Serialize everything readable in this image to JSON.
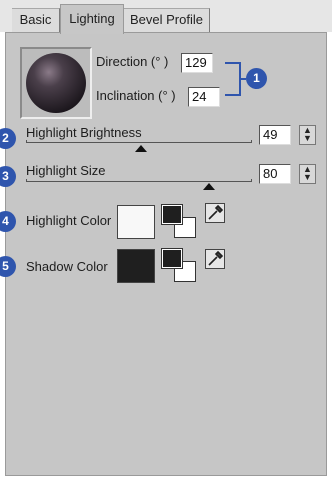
{
  "tabs": [
    {
      "label": "Basic",
      "active": false
    },
    {
      "label": "Lighting",
      "active": true
    },
    {
      "label": "Bevel Profile",
      "active": false
    }
  ],
  "lighting": {
    "direction": {
      "label": "Direction (°  )",
      "value": "129"
    },
    "inclination": {
      "label": "Inclination (°  )",
      "value": "24"
    },
    "highlight_brightness": {
      "label": "Highlight Brightness",
      "value": "49",
      "level": 0.49
    },
    "highlight_size": {
      "label": "Highlight Size",
      "value": "80",
      "level": 0.8
    },
    "highlight_color": {
      "label": "Highlight Color",
      "color": "#f8f8f8"
    },
    "shadow_color": {
      "label": "Shadow Color",
      "color": "#1f1f1f"
    }
  },
  "callouts": [
    "1",
    "2",
    "3",
    "4",
    "5"
  ],
  "colors": {
    "panel": "#c6c6c6",
    "callout": "#2f55ad",
    "sphere": "#4a3f4a"
  }
}
